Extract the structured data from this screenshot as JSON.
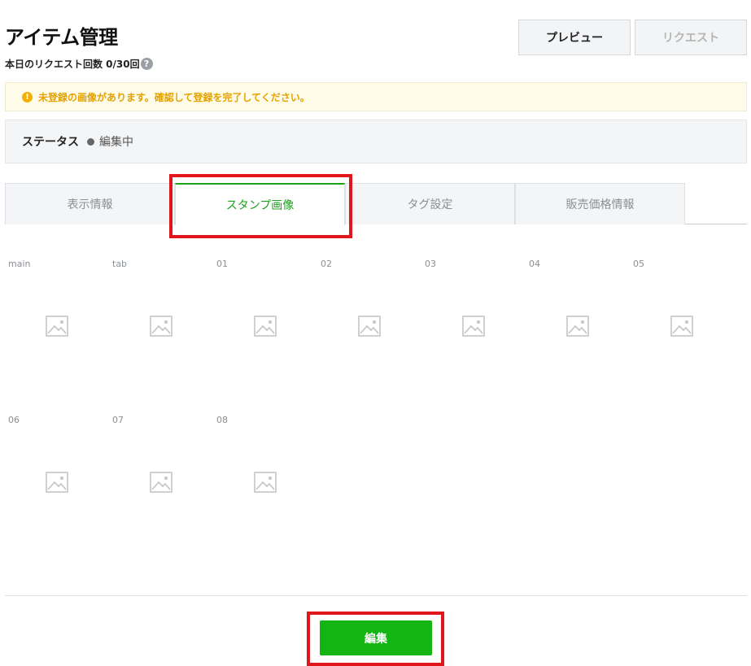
{
  "page": {
    "title": "アイテム管理",
    "request_count": "本日のリクエスト回数 0/30回",
    "help_icon": "?"
  },
  "buttons": {
    "preview": "プレビュー",
    "request": "リクエスト",
    "edit": "編集"
  },
  "notice": {
    "icon": "!",
    "text": "未登録の画像があります。確認して登録を完了してください。"
  },
  "status": {
    "label": "ステータス",
    "value": "編集中"
  },
  "tabs": [
    {
      "label": "表示情報",
      "active": false
    },
    {
      "label": "スタンプ画像",
      "active": true
    },
    {
      "label": "タグ設定",
      "active": false
    },
    {
      "label": "販売価格情報",
      "active": false
    }
  ],
  "stamp_slots": [
    {
      "label": "main",
      "icon": "image-placeholder-icon"
    },
    {
      "label": "tab",
      "icon": "image-placeholder-icon"
    },
    {
      "label": "01",
      "icon": "image-placeholder-icon"
    },
    {
      "label": "02",
      "icon": "image-placeholder-icon"
    },
    {
      "label": "03",
      "icon": "image-placeholder-icon"
    },
    {
      "label": "04",
      "icon": "image-placeholder-icon"
    },
    {
      "label": "05",
      "icon": "image-placeholder-icon"
    },
    {
      "label": "06",
      "icon": "image-placeholder-icon"
    },
    {
      "label": "07",
      "icon": "image-placeholder-icon"
    },
    {
      "label": "08",
      "icon": "image-placeholder-icon"
    }
  ],
  "colors": {
    "accent_green": "#13b513",
    "highlight_red": "#e0161b",
    "notice_text": "#e5a100"
  }
}
